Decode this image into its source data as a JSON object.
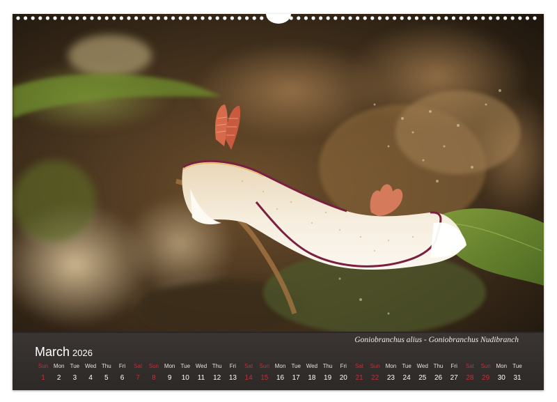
{
  "caption": "Goniobranchus alius - Goniobranchus Nudibranch",
  "month": {
    "name": "March",
    "year": "2026"
  },
  "days": [
    {
      "dn": "Sun",
      "num": "1",
      "weekend": true
    },
    {
      "dn": "Mon",
      "num": "2",
      "weekend": false
    },
    {
      "dn": "Tue",
      "num": "3",
      "weekend": false
    },
    {
      "dn": "Wed",
      "num": "4",
      "weekend": false
    },
    {
      "dn": "Thu",
      "num": "5",
      "weekend": false
    },
    {
      "dn": "Fri",
      "num": "6",
      "weekend": false
    },
    {
      "dn": "Sat",
      "num": "7",
      "weekend": true
    },
    {
      "dn": "Sun",
      "num": "8",
      "weekend": true
    },
    {
      "dn": "Mon",
      "num": "9",
      "weekend": false
    },
    {
      "dn": "Tue",
      "num": "10",
      "weekend": false
    },
    {
      "dn": "Wed",
      "num": "11",
      "weekend": false
    },
    {
      "dn": "Thu",
      "num": "12",
      "weekend": false
    },
    {
      "dn": "Fri",
      "num": "13",
      "weekend": false
    },
    {
      "dn": "Sat",
      "num": "14",
      "weekend": true
    },
    {
      "dn": "Sun",
      "num": "15",
      "weekend": true
    },
    {
      "dn": "Mon",
      "num": "16",
      "weekend": false
    },
    {
      "dn": "Tue",
      "num": "17",
      "weekend": false
    },
    {
      "dn": "Wed",
      "num": "18",
      "weekend": false
    },
    {
      "dn": "Thu",
      "num": "19",
      "weekend": false
    },
    {
      "dn": "Fri",
      "num": "20",
      "weekend": false
    },
    {
      "dn": "Sat",
      "num": "21",
      "weekend": true
    },
    {
      "dn": "Sun",
      "num": "22",
      "weekend": true
    },
    {
      "dn": "Mon",
      "num": "23",
      "weekend": false
    },
    {
      "dn": "Tue",
      "num": "24",
      "weekend": false
    },
    {
      "dn": "Wed",
      "num": "25",
      "weekend": false
    },
    {
      "dn": "Thu",
      "num": "26",
      "weekend": false
    },
    {
      "dn": "Fri",
      "num": "27",
      "weekend": false
    },
    {
      "dn": "Sat",
      "num": "28",
      "weekend": true
    },
    {
      "dn": "Sun",
      "num": "29",
      "weekend": true
    },
    {
      "dn": "Mon",
      "num": "30",
      "weekend": false
    },
    {
      "dn": "Tue",
      "num": "31",
      "weekend": false
    }
  ],
  "colors": {
    "weekend": "#c0303b",
    "bar": "#2d2927",
    "slug_body": "#f6eedf",
    "slug_rim": "#7a1f3f",
    "gills": "#d66a4a"
  }
}
